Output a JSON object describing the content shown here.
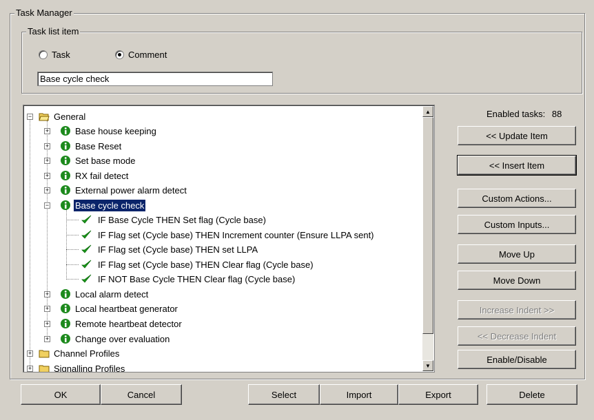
{
  "task_manager": {
    "title": "Task Manager"
  },
  "task_list_item": {
    "title": "Task list item",
    "radio_task": {
      "label": "Task",
      "selected": false
    },
    "radio_comment": {
      "label": "Comment",
      "selected": true
    },
    "input_value": "Base cycle check"
  },
  "enabled_tasks": {
    "label": "Enabled tasks:",
    "value": "88"
  },
  "tree": {
    "general": "General",
    "items": [
      {
        "label": "Base house keeping"
      },
      {
        "label": "Base Reset"
      },
      {
        "label": "Set base mode"
      },
      {
        "label": "RX fail detect"
      },
      {
        "label": "External power alarm detect"
      },
      {
        "label": "Base cycle check"
      },
      {
        "label": "IF Base Cycle THEN Set flag (Cycle base)"
      },
      {
        "label": "IF Flag set (Cycle base) THEN Increment counter (Ensure LLPA sent)"
      },
      {
        "label": "IF Flag set (Cycle base) THEN set LLPA"
      },
      {
        "label": "IF Flag set (Cycle base) THEN Clear flag (Cycle base)"
      },
      {
        "label": "IF NOT Base Cycle THEN Clear flag (Cycle base)"
      },
      {
        "label": "Local alarm detect"
      },
      {
        "label": "Local heartbeat generator"
      },
      {
        "label": "Remote heartbeat detector"
      },
      {
        "label": "Change over evaluation"
      }
    ],
    "channel_profiles": "Channel Profiles",
    "signalling_profiles": "Signalling Profiles"
  },
  "buttons": {
    "update_item": "<< Update Item",
    "insert_item": "<< Insert Item",
    "custom_actions": "Custom Actions...",
    "custom_inputs": "Custom Inputs...",
    "move_up": "Move Up",
    "move_down": "Move Down",
    "increase_indent": "Increase Indent >>",
    "decrease_indent": "<< Decrease Indent",
    "enable_disable": "Enable/Disable",
    "ok": "OK",
    "cancel": "Cancel",
    "select": "Select",
    "import": "Import",
    "export": "Export",
    "delete": "Delete"
  },
  "colors": {
    "selection": "#0a246a",
    "info_icon": "#1d8a1d",
    "check_icon": "#1a9a1a",
    "folder": "#f0d060"
  }
}
